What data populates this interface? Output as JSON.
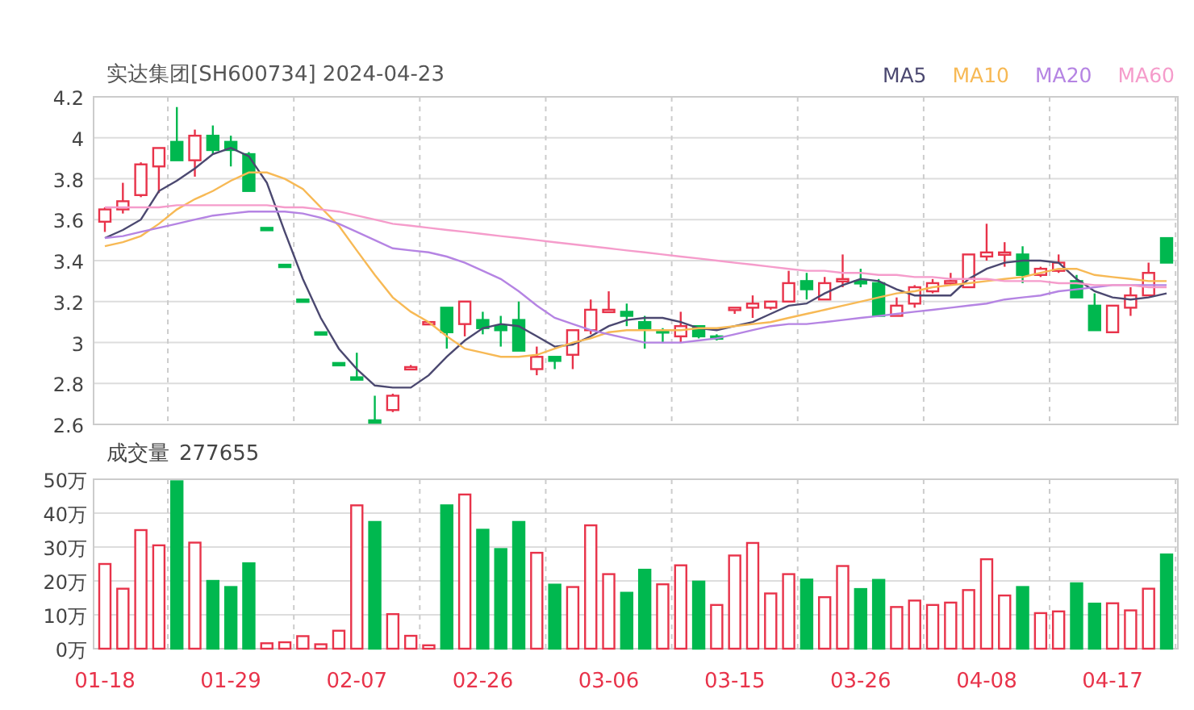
{
  "header": {
    "title": "实达集团[SH600734] 2024-04-23"
  },
  "price_chart": {
    "chart_data": {
      "type": "candlestick",
      "grid": true,
      "ylim": [
        2.6,
        4.2
      ],
      "yticks": [
        2.6,
        2.8,
        3,
        3.2,
        3.4,
        3.6,
        3.8,
        4,
        4.2
      ],
      "categories": [
        null,
        null,
        null,
        null,
        null,
        null,
        null,
        null,
        null,
        null,
        null,
        null,
        null,
        null,
        null,
        null,
        null,
        null,
        null,
        null,
        null,
        null,
        null,
        null,
        null,
        null,
        null,
        null,
        null,
        null,
        null,
        null,
        null,
        null,
        null,
        null,
        null,
        null,
        null,
        null,
        null,
        null,
        null,
        null,
        null,
        null,
        null,
        null,
        null,
        null,
        null,
        null,
        null,
        null,
        null,
        null,
        null,
        null,
        null,
        null
      ],
      "ohlc": [
        [
          3.59,
          3.66,
          3.54,
          3.65
        ],
        [
          3.65,
          3.78,
          3.63,
          3.69
        ],
        [
          3.72,
          3.88,
          3.71,
          3.87
        ],
        [
          3.86,
          3.95,
          3.73,
          3.95
        ],
        [
          3.98,
          4.15,
          3.89,
          3.89
        ],
        [
          3.89,
          4.04,
          3.81,
          4.01
        ],
        [
          4.01,
          4.06,
          3.92,
          3.94
        ],
        [
          3.98,
          4.01,
          3.86,
          3.94
        ],
        [
          3.92,
          3.93,
          3.74,
          3.74
        ],
        [
          3.56,
          3.56,
          3.55,
          3.55
        ],
        [
          3.38,
          3.38,
          3.37,
          3.37
        ],
        [
          3.21,
          3.21,
          3.2,
          3.2
        ],
        [
          3.05,
          3.05,
          3.04,
          3.04
        ],
        [
          2.9,
          2.9,
          2.89,
          2.89
        ],
        [
          2.83,
          2.95,
          2.82,
          2.82
        ],
        [
          2.62,
          2.74,
          2.61,
          2.61
        ],
        [
          2.67,
          2.75,
          2.66,
          2.74
        ],
        [
          2.88,
          2.89,
          2.87,
          2.88
        ],
        [
          3.09,
          3.1,
          3.09,
          3.1
        ],
        [
          3.17,
          3.17,
          2.97,
          3.05
        ],
        [
          3.09,
          3.2,
          3.03,
          3.2
        ],
        [
          3.11,
          3.15,
          3.04,
          3.07
        ],
        [
          3.08,
          3.13,
          2.98,
          3.06
        ],
        [
          3.11,
          3.2,
          2.96,
          2.96
        ],
        [
          2.87,
          2.98,
          2.84,
          2.93
        ],
        [
          2.93,
          2.93,
          2.87,
          2.91
        ],
        [
          2.94,
          3.06,
          2.87,
          3.06
        ],
        [
          3.06,
          3.21,
          3.04,
          3.16
        ],
        [
          3.15,
          3.25,
          3.15,
          3.16
        ],
        [
          3.15,
          3.19,
          3.08,
          3.13
        ],
        [
          3.1,
          3.13,
          2.97,
          3.07
        ],
        [
          3.06,
          3.07,
          3.0,
          3.05
        ],
        [
          3.03,
          3.15,
          3.0,
          3.08
        ],
        [
          3.08,
          3.08,
          3.02,
          3.03
        ],
        [
          3.03,
          3.04,
          3.01,
          3.02
        ],
        [
          3.16,
          3.17,
          3.14,
          3.17
        ],
        [
          3.17,
          3.23,
          3.12,
          3.19
        ],
        [
          3.17,
          3.2,
          3.16,
          3.2
        ],
        [
          3.2,
          3.35,
          3.2,
          3.29
        ],
        [
          3.3,
          3.34,
          3.21,
          3.26
        ],
        [
          3.21,
          3.32,
          3.21,
          3.29
        ],
        [
          3.3,
          3.43,
          3.27,
          3.31
        ],
        [
          3.3,
          3.36,
          3.27,
          3.29
        ],
        [
          3.29,
          3.31,
          3.13,
          3.13
        ],
        [
          3.13,
          3.22,
          3.13,
          3.18
        ],
        [
          3.19,
          3.28,
          3.17,
          3.27
        ],
        [
          3.25,
          3.31,
          3.24,
          3.29
        ],
        [
          3.29,
          3.34,
          3.28,
          3.3
        ],
        [
          3.27,
          3.43,
          3.27,
          3.43
        ],
        [
          3.42,
          3.58,
          3.4,
          3.44
        ],
        [
          3.43,
          3.49,
          3.37,
          3.44
        ],
        [
          3.43,
          3.47,
          3.29,
          3.33
        ],
        [
          3.33,
          3.37,
          3.32,
          3.36
        ],
        [
          3.35,
          3.43,
          3.34,
          3.39
        ],
        [
          3.3,
          3.33,
          3.22,
          3.22
        ],
        [
          3.18,
          3.24,
          3.06,
          3.06
        ],
        [
          3.05,
          3.18,
          3.05,
          3.18
        ],
        [
          3.17,
          3.27,
          3.13,
          3.23
        ],
        [
          3.23,
          3.39,
          3.23,
          3.34
        ],
        [
          3.51,
          3.51,
          3.39,
          3.39
        ]
      ],
      "series": [
        {
          "name": "MA5",
          "type": "line",
          "color": "#4b4870",
          "values": [
            3.51,
            3.55,
            3.6,
            3.74,
            3.79,
            3.85,
            3.92,
            3.95,
            3.91,
            3.78,
            3.54,
            3.31,
            3.12,
            2.97,
            2.87,
            2.79,
            2.78,
            2.78,
            2.84,
            2.93,
            3.01,
            3.07,
            3.09,
            3.08,
            3.03,
            2.98,
            2.99,
            3.03,
            3.08,
            3.11,
            3.12,
            3.12,
            3.1,
            3.07,
            3.06,
            3.08,
            3.1,
            3.14,
            3.18,
            3.19,
            3.24,
            3.28,
            3.31,
            3.3,
            3.26,
            3.23,
            3.23,
            3.23,
            3.31,
            3.36,
            3.39,
            3.4,
            3.4,
            3.39,
            3.31,
            3.25,
            3.22,
            3.21,
            3.22,
            3.24
          ]
        },
        {
          "name": "MA10",
          "type": "line",
          "color": "#f7b955",
          "values": [
            3.47,
            3.49,
            3.52,
            3.58,
            3.65,
            3.7,
            3.74,
            3.79,
            3.83,
            3.83,
            3.8,
            3.75,
            3.66,
            3.57,
            3.45,
            3.33,
            3.22,
            3.15,
            3.1,
            3.03,
            2.97,
            2.95,
            2.93,
            2.93,
            2.94,
            2.97,
            3.0,
            3.02,
            3.05,
            3.06,
            3.06,
            3.06,
            3.06,
            3.07,
            3.07,
            3.08,
            3.09,
            3.1,
            3.12,
            3.14,
            3.16,
            3.18,
            3.2,
            3.22,
            3.24,
            3.25,
            3.27,
            3.28,
            3.29,
            3.3,
            3.31,
            3.32,
            3.34,
            3.36,
            3.36,
            3.33,
            3.32,
            3.31,
            3.3,
            3.3
          ]
        },
        {
          "name": "MA20",
          "type": "line",
          "color": "#b584e3",
          "values": [
            3.51,
            3.52,
            3.54,
            3.56,
            3.58,
            3.6,
            3.62,
            3.63,
            3.64,
            3.64,
            3.64,
            3.63,
            3.61,
            3.58,
            3.54,
            3.5,
            3.46,
            3.45,
            3.44,
            3.42,
            3.39,
            3.35,
            3.31,
            3.25,
            3.18,
            3.12,
            3.09,
            3.06,
            3.04,
            3.02,
            3.0,
            3.0,
            3.0,
            3.01,
            3.02,
            3.04,
            3.06,
            3.08,
            3.09,
            3.09,
            3.1,
            3.11,
            3.12,
            3.13,
            3.14,
            3.15,
            3.16,
            3.17,
            3.18,
            3.19,
            3.21,
            3.22,
            3.23,
            3.25,
            3.26,
            3.27,
            3.28,
            3.28,
            3.28,
            3.28
          ]
        },
        {
          "name": "MA60",
          "type": "line",
          "color": "#f59ccb",
          "values": [
            3.66,
            3.66,
            3.66,
            3.66,
            3.67,
            3.67,
            3.67,
            3.67,
            3.67,
            3.67,
            3.66,
            3.66,
            3.65,
            3.64,
            3.62,
            3.6,
            3.58,
            3.57,
            3.56,
            3.55,
            3.54,
            3.53,
            3.52,
            3.51,
            3.5,
            3.49,
            3.48,
            3.47,
            3.46,
            3.45,
            3.44,
            3.43,
            3.42,
            3.41,
            3.4,
            3.39,
            3.38,
            3.37,
            3.36,
            3.35,
            3.35,
            3.34,
            3.34,
            3.33,
            3.33,
            3.32,
            3.32,
            3.31,
            3.31,
            3.31,
            3.3,
            3.3,
            3.3,
            3.29,
            3.29,
            3.28,
            3.28,
            3.28,
            3.27,
            3.27
          ]
        }
      ]
    }
  },
  "volume_chart": {
    "title": "成交量",
    "total": "277655",
    "chart_data": {
      "type": "bar",
      "grid": true,
      "ylim": [
        0,
        50
      ],
      "yticks": [
        {
          "value": 0,
          "label": "0万"
        },
        {
          "value": 10,
          "label": "10万"
        },
        {
          "value": 20,
          "label": "20万"
        },
        {
          "value": 30,
          "label": "30万"
        },
        {
          "value": 40,
          "label": "40万"
        },
        {
          "value": 50,
          "label": "50万"
        }
      ],
      "categories": [
        "01-18",
        null,
        null,
        null,
        null,
        null,
        null,
        "01-29",
        null,
        null,
        null,
        null,
        null,
        null,
        "02-07",
        null,
        null,
        null,
        null,
        null,
        null,
        "02-26",
        null,
        null,
        null,
        null,
        null,
        null,
        "03-06",
        null,
        null,
        null,
        null,
        null,
        null,
        "03-15",
        null,
        null,
        null,
        null,
        null,
        null,
        "03-26",
        null,
        null,
        null,
        null,
        null,
        null,
        "04-08",
        null,
        null,
        null,
        null,
        null,
        null,
        "04-17",
        null,
        null,
        null
      ],
      "series": [
        {
          "color": "#e8334a",
          "values": [
            25,
            17.7,
            35,
            30.5,
            null,
            31.3,
            null,
            null,
            null,
            1.6,
            1.9,
            3.7,
            1.3,
            5.3,
            42.3,
            null,
            10.2,
            3.8,
            1,
            null,
            45.5,
            null,
            null,
            null,
            28.3,
            null,
            18.2,
            36.4,
            22,
            null,
            null,
            19,
            24.6,
            null,
            12.9,
            27.5,
            31.2,
            16.3,
            22,
            null,
            15.2,
            24.4,
            null,
            null,
            12.3,
            14.2,
            12.9,
            13.6,
            17.3,
            26.4,
            15.7,
            null,
            10.5,
            11,
            null,
            null,
            13.4,
            11.3,
            17.7,
            null
          ]
        },
        {
          "color": "#00b84f",
          "values": [
            null,
            null,
            null,
            null,
            49.4,
            null,
            20,
            18.2,
            25.2,
            null,
            null,
            null,
            null,
            null,
            null,
            37.4,
            null,
            null,
            null,
            42.3,
            null,
            35.1,
            29.4,
            37.4,
            null,
            18.9,
            null,
            null,
            null,
            16.5,
            23.3,
            null,
            null,
            19.8,
            null,
            null,
            null,
            null,
            null,
            20.4,
            null,
            null,
            17.6,
            20.3,
            null,
            null,
            null,
            null,
            null,
            null,
            null,
            18.2,
            null,
            null,
            19.3,
            13.3,
            null,
            null,
            null,
            27.8
          ]
        }
      ]
    }
  }
}
